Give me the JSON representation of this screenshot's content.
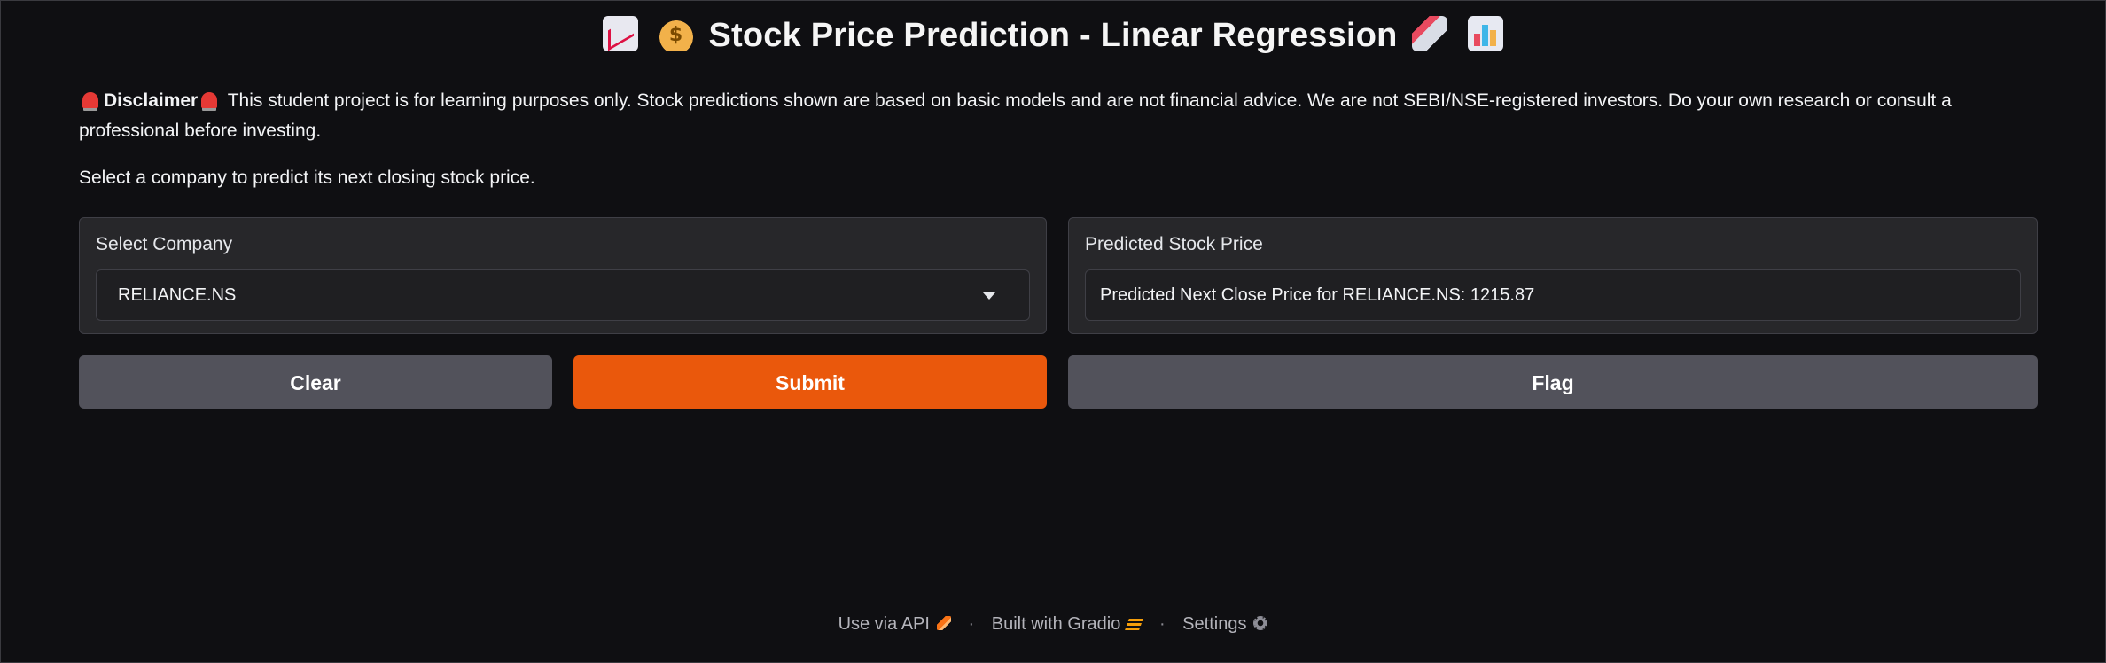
{
  "header": {
    "title": "Stock Price Prediction - Linear Regression",
    "icons": [
      "chart-increasing-icon",
      "money-bag-icon",
      "rocket-icon",
      "bar-chart-icon"
    ]
  },
  "disclaimer": {
    "label": "Disclaimer",
    "text": "This student project is for learning purposes only. Stock predictions shown are based on basic models and are not financial advice. We are not SEBI/NSE-registered investors. Do your own research or consult a professional before investing.",
    "icon": "siren-icon"
  },
  "instructions": "Select a company to predict its next closing stock price.",
  "input_panel": {
    "label": "Select Company",
    "selected_value": "RELIANCE.NS"
  },
  "output_panel": {
    "label": "Predicted Stock Price",
    "value": "Predicted Next Close Price for RELIANCE.NS: 1215.87"
  },
  "buttons": {
    "clear": "Clear",
    "submit": "Submit",
    "flag": "Flag"
  },
  "footer": {
    "api_link": "Use via API",
    "built_with": "Built with Gradio",
    "settings": "Settings",
    "separator": "·"
  },
  "colors": {
    "background": "#0f0f12",
    "panel": "#27272a",
    "submit_accent": "#ea580c",
    "secondary_button": "#52525b"
  }
}
